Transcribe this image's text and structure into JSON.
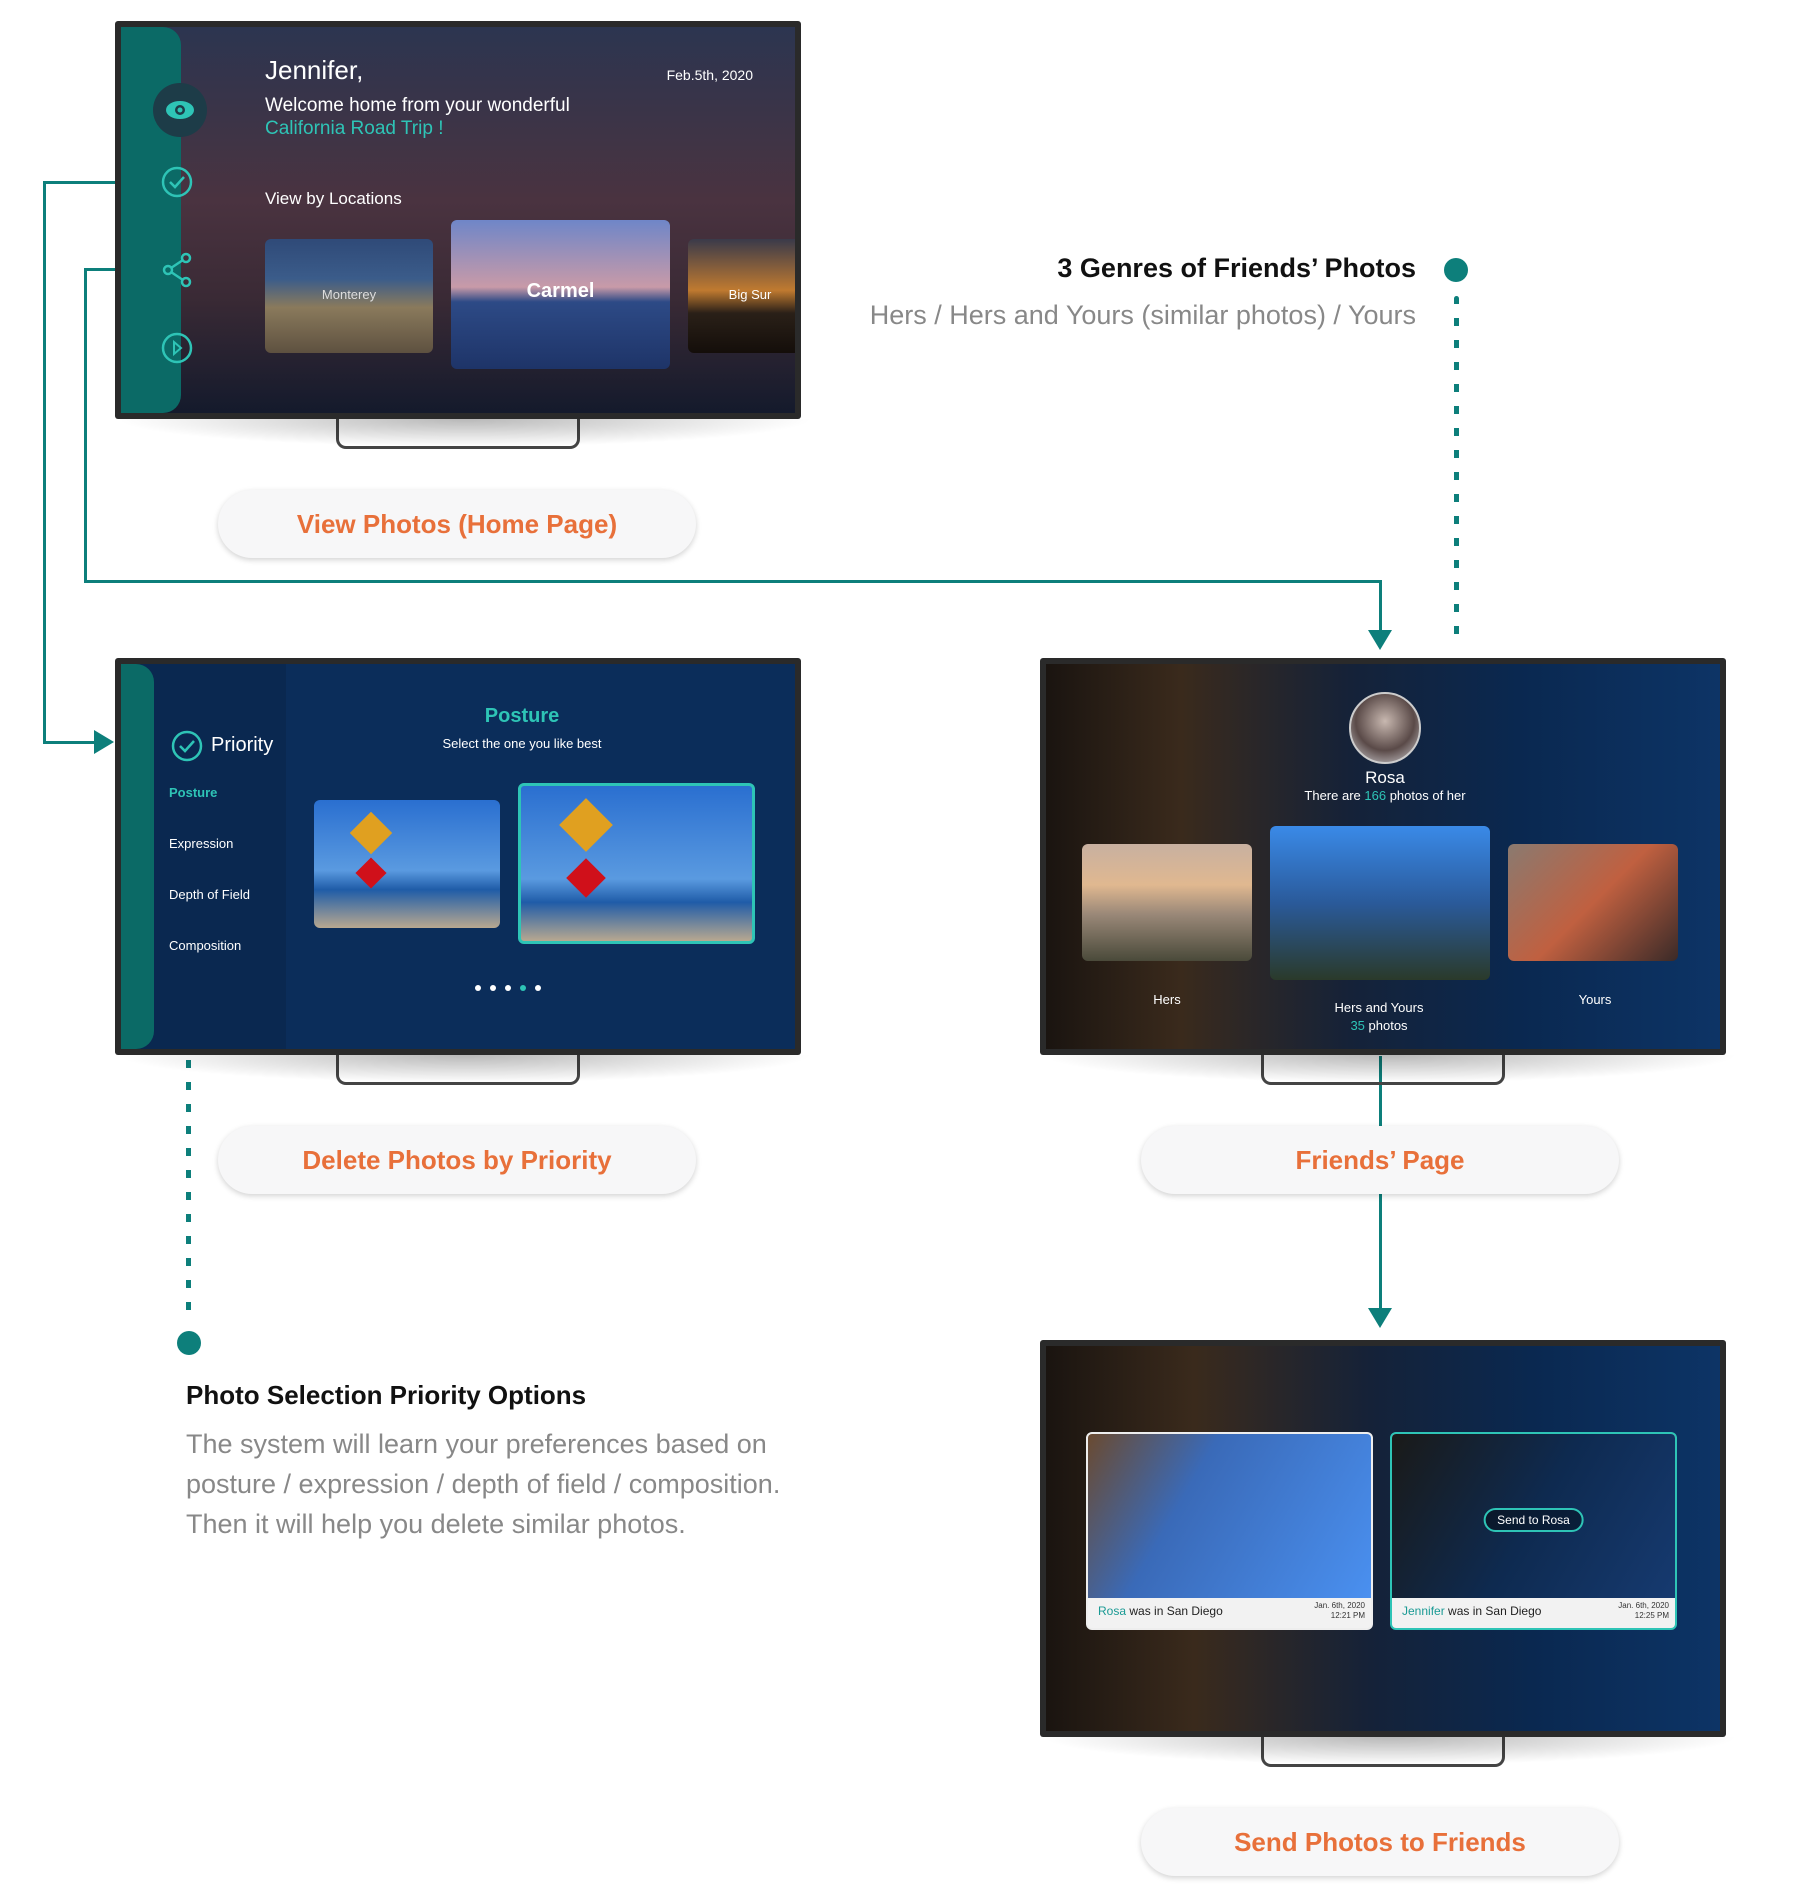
{
  "colors": {
    "accent": "#0d7f7b",
    "highlight": "#2ec4b6",
    "label": "#e8703a",
    "navy": "#0b2d5a"
  },
  "home": {
    "greeting": "Jennifer,",
    "date": "Feb.5th, 2020",
    "welcome": "Welcome home from your wonderful",
    "trip": "California Road Trip !",
    "section": "View by Locations",
    "locations": [
      "Monterey",
      "Carmel",
      "Big Sur"
    ],
    "sidebar_icons": [
      "eye-icon",
      "check-circle-icon",
      "share-icon",
      "play-icon"
    ],
    "caption": "View Photos (Home Page)"
  },
  "priority": {
    "heading": "Priority",
    "options": [
      "Posture",
      "Expression",
      "Depth of Field",
      "Composition"
    ],
    "active_option": "Posture",
    "title": "Posture",
    "subtitle": "Select the one you like best",
    "page_dots": 5,
    "active_dot": 4,
    "caption": "Delete Photos by Priority"
  },
  "friends": {
    "name": "Rosa",
    "count_prefix": "There are ",
    "count": "166",
    "count_suffix": " photos of her",
    "genres": [
      {
        "label": "Hers"
      },
      {
        "label": "Hers and Yours",
        "count": "35",
        "count_suffix": " photos"
      },
      {
        "label": "Yours"
      }
    ],
    "caption": "Friends’ Page"
  },
  "send": {
    "cards": [
      {
        "name": "Rosa",
        "text": " was in San Diego",
        "date": "Jan. 6th, 2020",
        "time": "12:21 PM"
      },
      {
        "name": "Jennifer",
        "text": " was in San Diego",
        "date": "Jan. 6th, 2020",
        "time": "12:25 PM"
      }
    ],
    "send_button": "Send to Rosa",
    "caption": "Send Photos to Friends"
  },
  "notes": {
    "genres_title": "3 Genres of Friends’ Photos",
    "genres_sub": "Hers / Hers and Yours (similar photos) / Yours",
    "priority_title": "Photo Selection Priority Options",
    "priority_lines": [
      "The system will learn your preferences based on",
      "posture / expression / depth of field / composition.",
      "Then it will help you delete similar photos."
    ]
  }
}
